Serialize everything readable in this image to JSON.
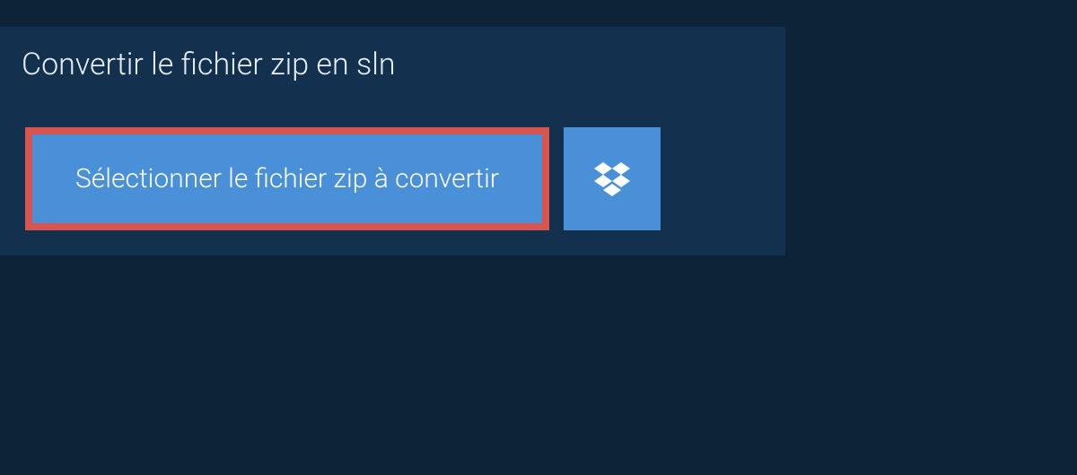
{
  "header": {
    "title": "Convertir le fichier zip en sln"
  },
  "actions": {
    "select_file_label": "Sélectionner le fichier zip à convertir"
  }
}
